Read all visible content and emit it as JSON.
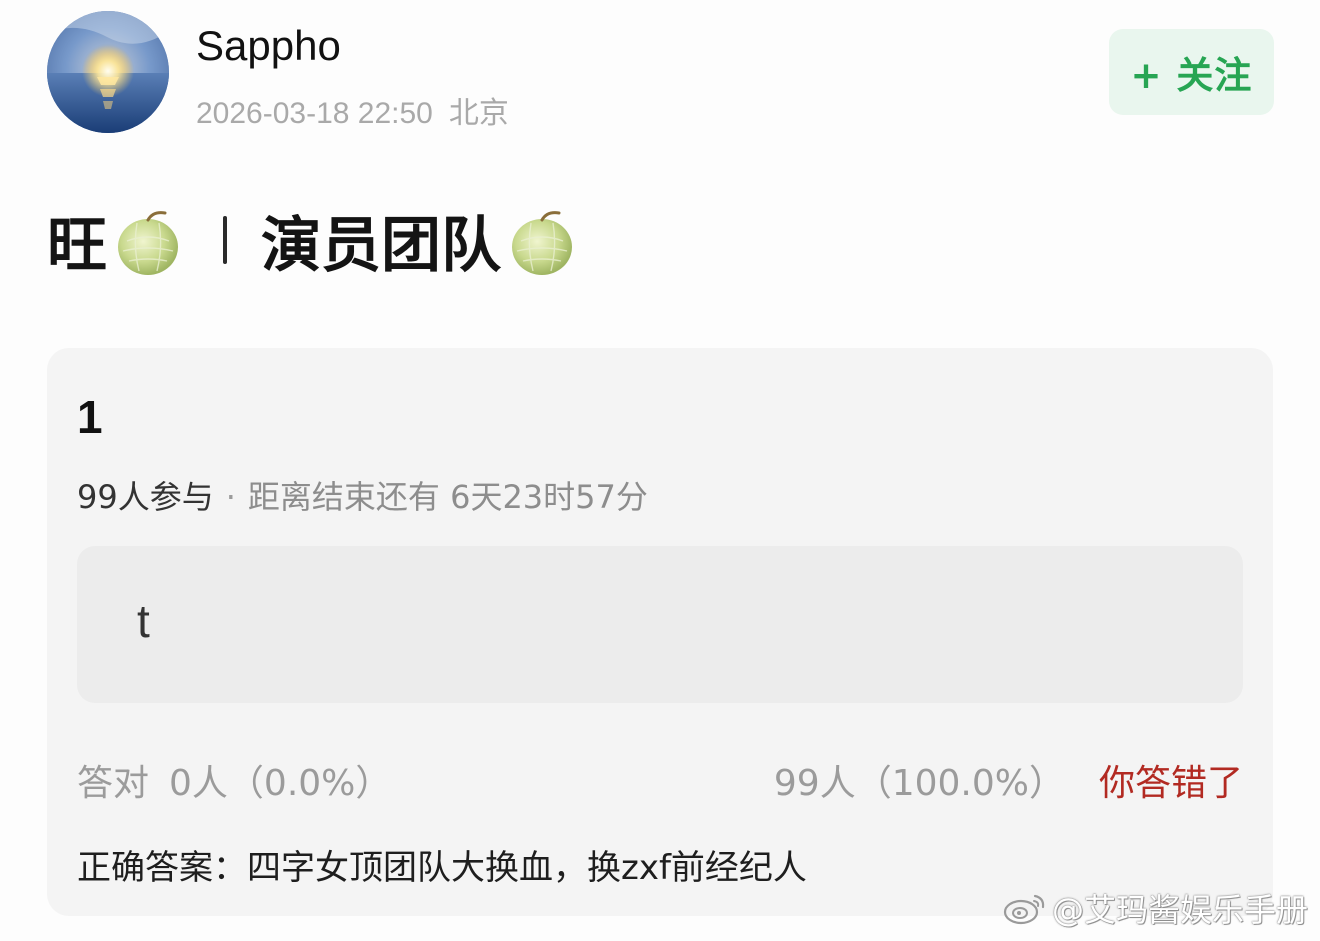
{
  "post": {
    "username": "Sappho",
    "datetime": "2026-03-18 22:50",
    "location": "北京",
    "follow_label": "+ 关注"
  },
  "title": {
    "part1": "旺",
    "part2": "演员团队",
    "emoji": "melon-icon"
  },
  "quiz": {
    "question": "1",
    "participants": "99人参与",
    "separator": "·",
    "remaining": "距离结束还有 6天23时57分",
    "options": [
      {
        "text": "t"
      }
    ],
    "correct_label": "答对",
    "correct_stats": "0人（0.0%）",
    "wrong_stats": "99人（100.0%）",
    "wrong_label": "你答错了",
    "answer": "正确答案：四字女顶团队大换血，换zxf前经纪人"
  },
  "watermark": {
    "text": "@艾玛酱娱乐手册",
    "icon": "weibo-icon"
  },
  "colors": {
    "follow_bg": "#e9f6ee",
    "follow_text": "#27a553",
    "wrong_label": "#b22a22",
    "card_bg": "#f4f4f4",
    "option_bg": "#ececec"
  }
}
